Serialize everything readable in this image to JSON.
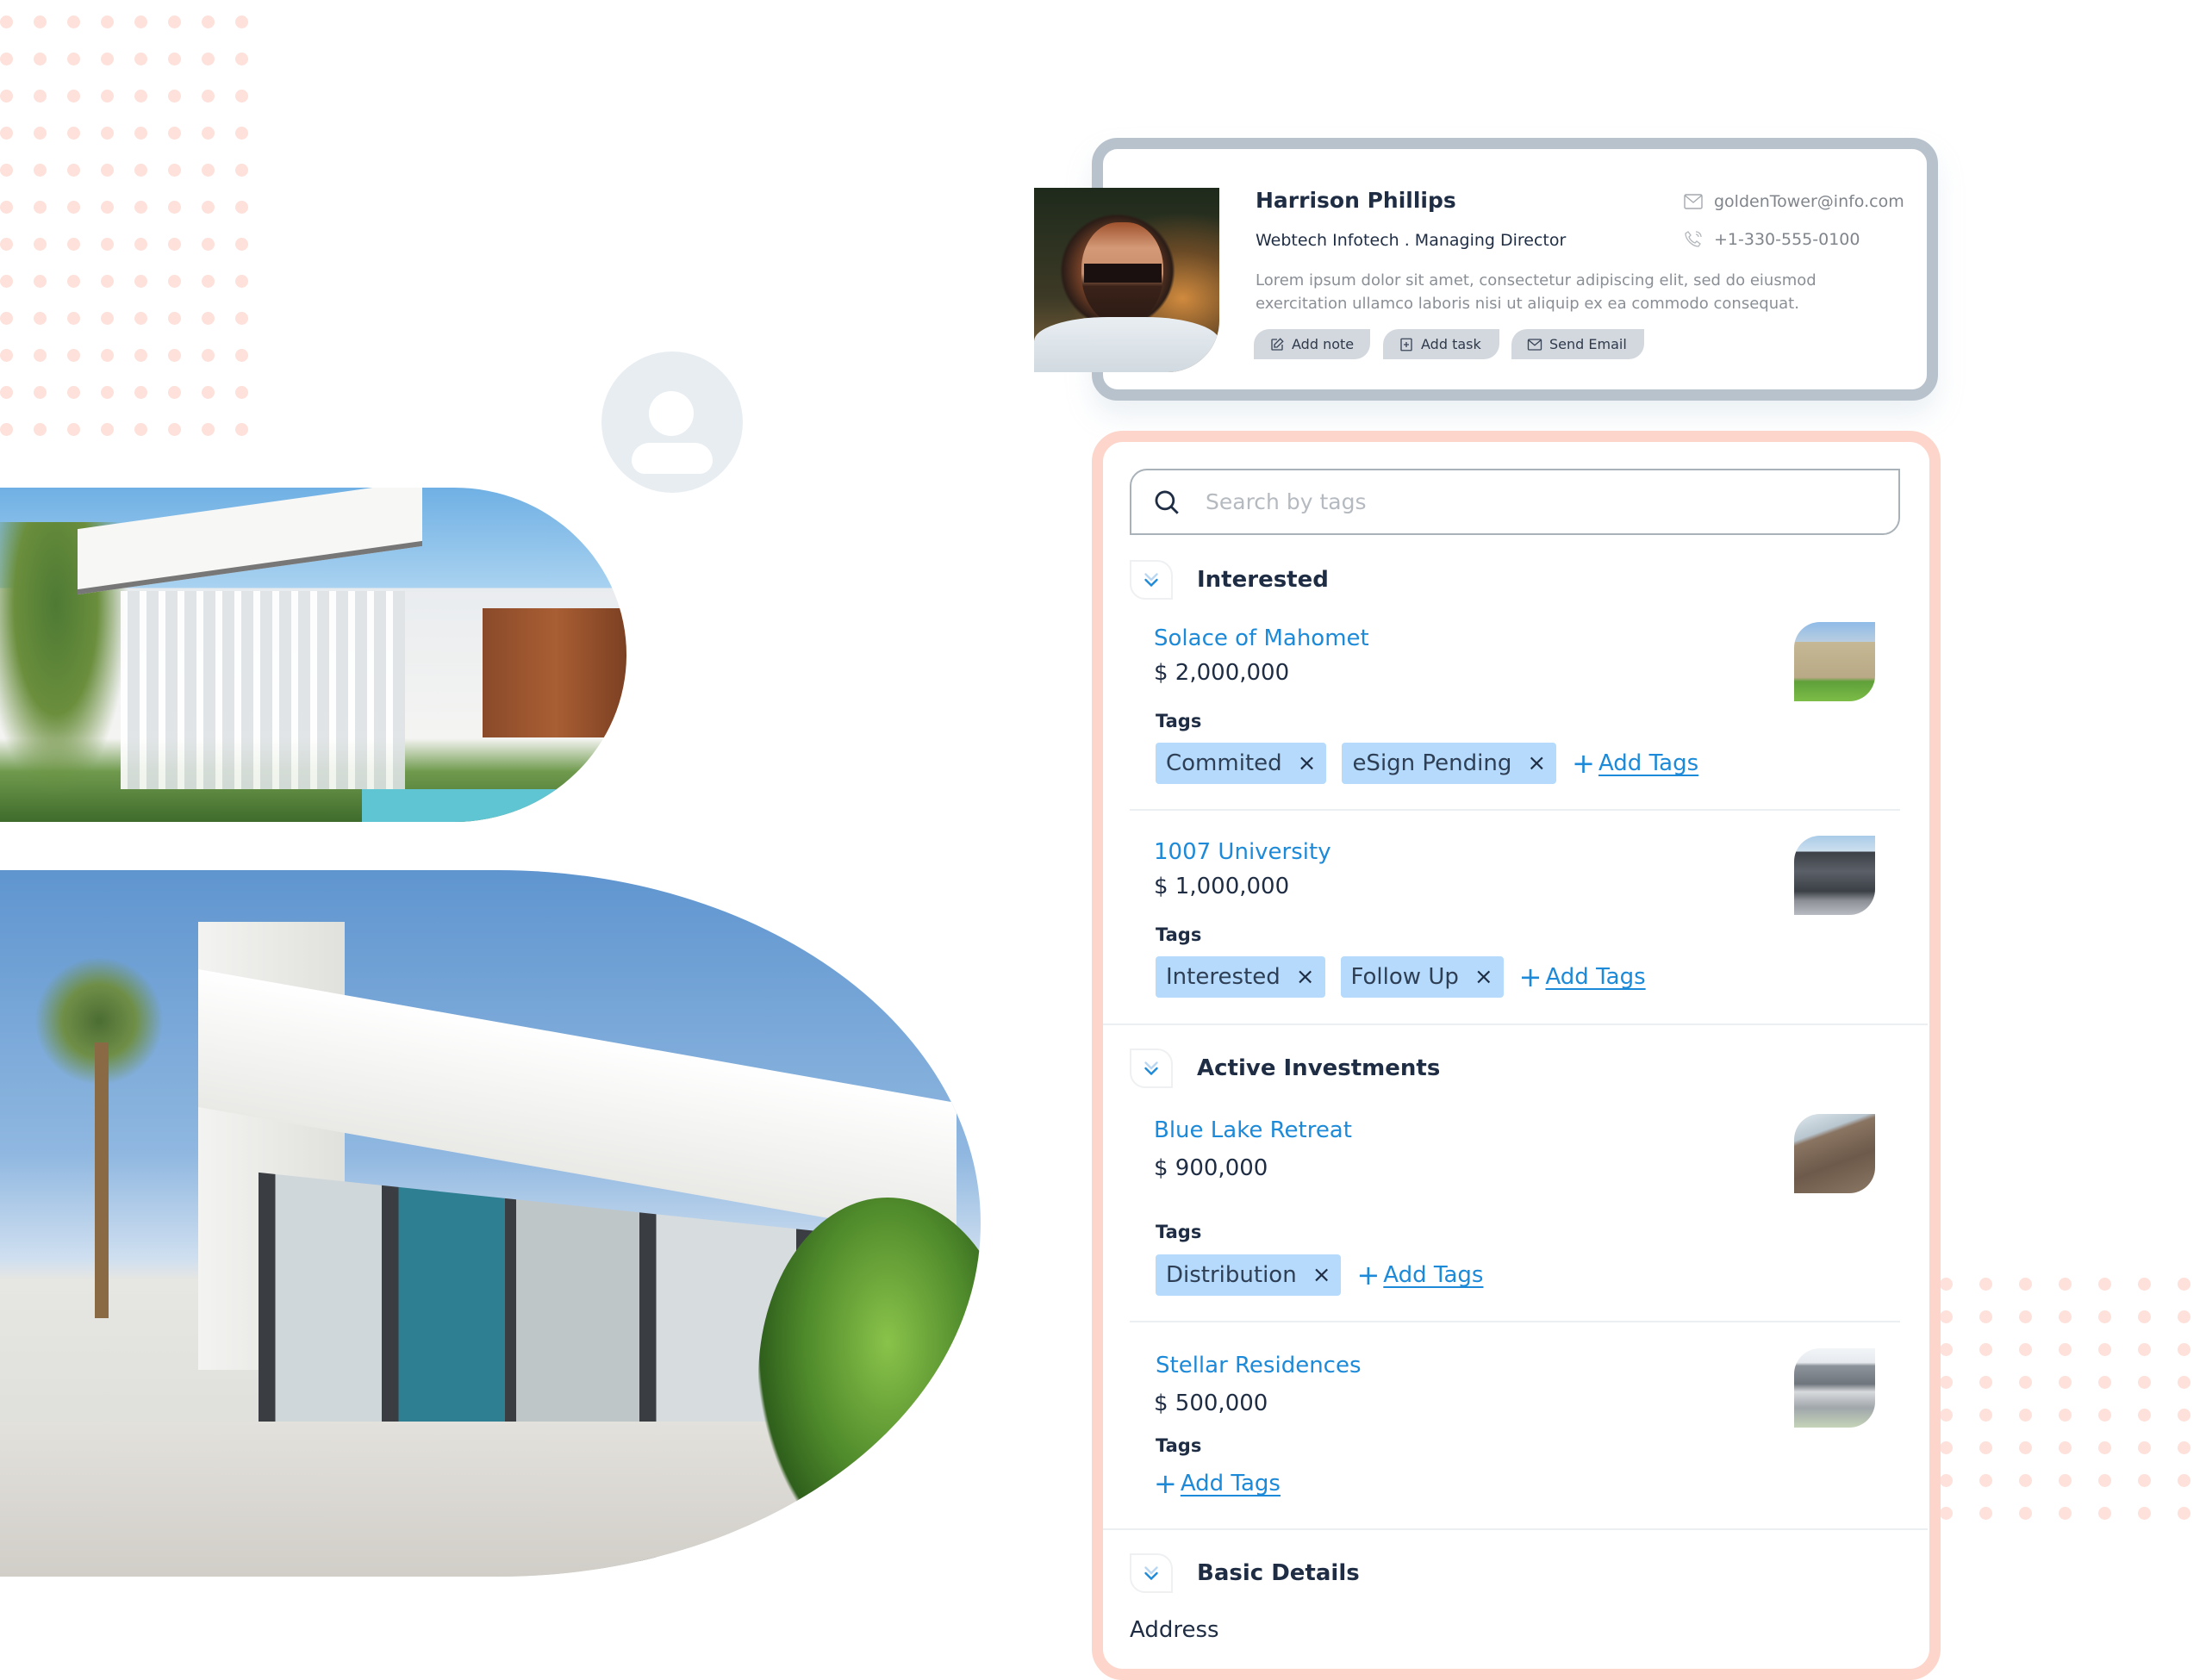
{
  "contact": {
    "name": "Harrison Phillips",
    "company_role": "Webtech Infotech . Managing Director",
    "bio": "Lorem ipsum dolor sit amet, consectetur adipiscing elit, sed do eiusmod exercitation ullamco laboris nisi ut aliquip ex ea commodo consequat.",
    "email": "goldenTower@info.com",
    "phone": "+1-330-555-0100",
    "actions": [
      {
        "label": "Add note",
        "icon": "edit-icon"
      },
      {
        "label": "Add task",
        "icon": "plus-square-icon"
      },
      {
        "label": "Send Email",
        "icon": "mail-icon"
      }
    ]
  },
  "search": {
    "placeholder": "Search by tags",
    "value": ""
  },
  "sections": [
    {
      "title": "Interested",
      "properties": [
        {
          "name": "Solace of Mahomet",
          "price": "$ 2,000,000",
          "tags_label": "Tags",
          "tags": [
            "Commited",
            "eSign Pending"
          ],
          "add_tags_label": "Add Tags"
        },
        {
          "name": "1007 University",
          "price": "$ 1,000,000",
          "tags_label": "Tags",
          "tags": [
            "Interested",
            "Follow Up"
          ],
          "add_tags_label": "Add Tags"
        }
      ]
    },
    {
      "title": "Active Investments",
      "properties": [
        {
          "name": "Blue Lake Retreat",
          "price": "$ 900,000",
          "tags_label": "Tags",
          "tags": [
            "Distribution"
          ],
          "add_tags_label": "Add Tags"
        },
        {
          "name": "Stellar Residences",
          "price": "$ 500,000",
          "tags_label": "Tags",
          "tags": [],
          "add_tags_label": "Add Tags"
        }
      ]
    },
    {
      "title": "Basic Details",
      "fields": [
        {
          "label": "Address"
        }
      ]
    }
  ],
  "icons": {
    "remove_tag": "×",
    "add": "+"
  },
  "colors": {
    "accent_blue": "#1c8ad8",
    "tag_bg": "#b5dafb",
    "panel_border": "#fdd5ca",
    "card_border": "#b8c2cc",
    "dot": "#fde1da"
  }
}
